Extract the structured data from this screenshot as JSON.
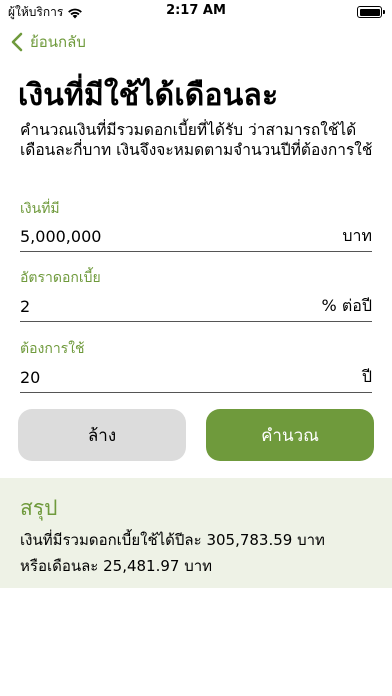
{
  "status_bar": {
    "carrier": "ผู้ให้บริการ",
    "time": "2:17 AM",
    "icons": [
      "wifi-icon",
      "battery-icon"
    ]
  },
  "nav": {
    "back_label": "ย้อนกลับ",
    "back_icon": "chevron-left-icon"
  },
  "page": {
    "title": "เงินที่มีใช้ได้เดือนละ",
    "description": "คำนวณเงินที่มีรวมดอกเบี้ยที่ได้รับ ว่าสามารถใช้ได้เดือนละกี่บาท เงินจึงจะหมดตามจำนวนปีที่ต้องการใช้"
  },
  "fields": {
    "amount": {
      "label": "เงินที่มี",
      "value": "5,000,000",
      "unit": "บาท"
    },
    "rate": {
      "label": "อัตราดอกเบี้ย",
      "value": "2",
      "unit": "% ต่อปี"
    },
    "years": {
      "label": "ต้องการใช้",
      "value": "20",
      "unit": "ปี"
    }
  },
  "buttons": {
    "clear_label": "ล้าง",
    "calculate_label": "คำนวณ"
  },
  "summary": {
    "title": "สรุป",
    "yearly_line": "เงินที่มีรวมดอกเบี้ยใช้ได้ปีละ 305,783.59 บาท",
    "monthly_line": "หรือเดือนละ 25,481.97 บาท"
  },
  "colors": {
    "accent": "#6f9a3c",
    "summary_bg": "#eef2e6",
    "clear_button_bg": "#dcdcdc"
  }
}
